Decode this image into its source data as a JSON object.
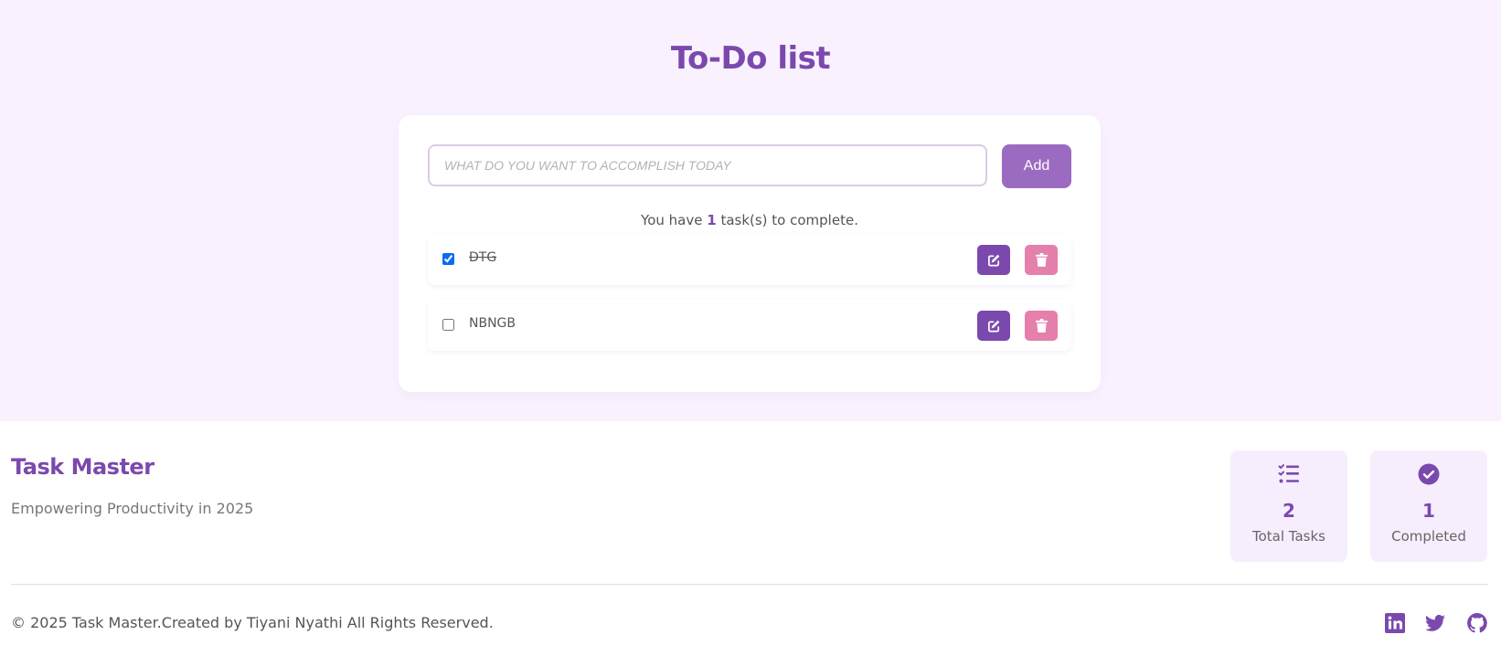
{
  "page": {
    "title": "To-Do list"
  },
  "todo": {
    "input_placeholder": "WHAT DO YOU WANT TO ACCOMPLISH TODAY",
    "input_value": "",
    "add_label": "Add",
    "count_prefix": "You have ",
    "count_value": "1",
    "count_suffix": " task(s) to complete.",
    "tasks": [
      {
        "label": "DTG",
        "completed": true
      },
      {
        "label": "NBNGB",
        "completed": false
      }
    ]
  },
  "footer": {
    "brand": "Task Master",
    "tagline": "Empowering Productivity in 2025",
    "stats": [
      {
        "icon": "task-list-icon",
        "value": "2",
        "label": "Total Tasks"
      },
      {
        "icon": "check-circle-icon",
        "value": "1",
        "label": "Completed"
      }
    ],
    "copyright": "© 2025 Task Master.Created by Tiyani Nyathi All Rights Reserved.",
    "social": [
      "linkedin-icon",
      "twitter-icon",
      "github-icon"
    ]
  },
  "colors": {
    "brand": "#7b49ad",
    "add_button": "#9b6bc1",
    "delete_button": "#e57fab",
    "hero_background": "#f9f2fe",
    "stat_card_background": "#f6eefd",
    "checkbox_accent": "#0b6cf0"
  }
}
